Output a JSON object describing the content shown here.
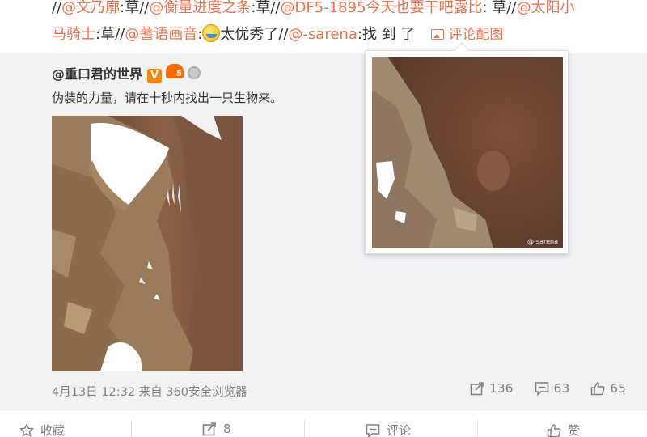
{
  "comment": {
    "segments": [
      {
        "type": "plain",
        "text": "//"
      },
      {
        "type": "mention",
        "text": "@文乃廓"
      },
      {
        "type": "plain",
        "text": ":草//"
      },
      {
        "type": "mention",
        "text": "@衡量进度之条"
      },
      {
        "type": "plain",
        "text": ":草//"
      },
      {
        "type": "mention",
        "text": "@DF5-1895今天也要干吧露比"
      },
      {
        "type": "plain",
        "text": ": 草//"
      },
      {
        "type": "mention",
        "text": "@太阳小"
      }
    ],
    "line2": {
      "m1": "马骑士",
      "p1": ":草//",
      "m2": "@蓍语画音",
      "p2": ":",
      "p3": "太优秀了//",
      "m3": "@-sarena",
      "p4": ":找 到 了",
      "pic_link": "评论配图"
    }
  },
  "repost": {
    "author": "@重口君的世界",
    "v_badge": "V",
    "text": "伪装的力量，请在十秒内找出一只生物来。",
    "time": "4月13日 12:32",
    "from_prefix": "来自",
    "source": "360安全浏览器",
    "counts": {
      "repost": "136",
      "comment": "63",
      "like": "65"
    }
  },
  "popup": {
    "watermark": "@-sarena"
  },
  "actions": {
    "favorite": "收藏",
    "forward": "8",
    "comment": "评论",
    "like": "赞"
  },
  "colors": {
    "mention": "#eb7350",
    "bg_repost": "#f2f2f5",
    "text": "#333333",
    "meta": "#808080"
  }
}
